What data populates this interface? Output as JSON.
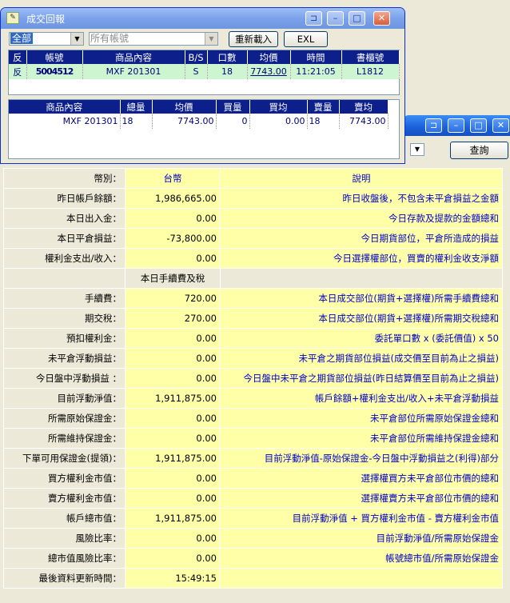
{
  "bg_window": {
    "query_button": "查詢",
    "summary": {
      "header": {
        "label": "幣別：",
        "currency": "台幣",
        "desc": "說明"
      },
      "section_label": "本日手續費及稅",
      "rows": [
        {
          "label": "昨日帳戶餘額：",
          "value": "1,986,665.00",
          "desc": "昨日收盤後，不包含未平倉損益之金額"
        },
        {
          "label": "本日出入金：",
          "value": "0.00",
          "desc": "今日存款及提款的金額總和"
        },
        {
          "label": "本日平倉損益：",
          "value": "-73,800.00",
          "desc": "今日期貨部位，平倉所造成的損益"
        },
        {
          "label": "權利金支出/收入：",
          "value": "0.00",
          "desc": "今日選擇權部位，買賣的權利金收支淨額"
        }
      ],
      "rows2": [
        {
          "label": "手續費：",
          "value": "720.00",
          "desc": "本日成交部位(期貨+選擇權)所需手續費總和"
        },
        {
          "label": "期交稅：",
          "value": "270.00",
          "desc": "本日成交部位(期貨+選擇權)所需期交稅總和"
        },
        {
          "label": "預扣權利金：",
          "value": "0.00",
          "desc": "委託單口數 x (委託價值) x 50"
        },
        {
          "label": "未平倉浮動損益：",
          "value": "0.00",
          "desc": "未平倉之期貨部位損益(成交價至目前為止之損益)"
        },
        {
          "label": "今日盤中浮動損益 ：",
          "value": "0.00",
          "desc": "今日盤中未平倉之期貨部位損益(昨日結算價至目前為止之損益)"
        },
        {
          "label": "目前浮動淨值：",
          "value": "1,911,875.00",
          "desc": "帳戶餘額+權利金支出/收入+未平倉浮動損益"
        },
        {
          "label": "所需原始保證金：",
          "value": "0.00",
          "desc": "未平倉部位所需原始保證金總和"
        },
        {
          "label": "所需維持保證金：",
          "value": "0.00",
          "desc": "未平倉部位所需維持保證金總和"
        },
        {
          "label": "下單可用保證金(提領)：",
          "value": "1,911,875.00",
          "desc": "目前浮動淨值-原始保證金-今日盤中浮動損益之(利得)部分"
        },
        {
          "label": "買方權利金市值：",
          "value": "0.00",
          "desc": "選擇權買方未平倉部位市價的總和"
        },
        {
          "label": "賣方權利金市值：",
          "value": "0.00",
          "desc": "選擇權賣方未平倉部位市價的總和"
        },
        {
          "label": "帳戶總市值：",
          "value": "1,911,875.00",
          "desc": "目前浮動淨值 + 買方權利金市值 - 賣方權利金市值"
        },
        {
          "label": "風險比率：",
          "value": "0.00",
          "desc": "目前浮動淨值/所需原始保證金"
        },
        {
          "label": "總市值風險比率：",
          "value": "0.00",
          "desc": "帳號總市值/所需原始保證金"
        },
        {
          "label": "最後資料更新時間：",
          "value": "15:49:15",
          "desc": ""
        }
      ]
    }
  },
  "fg_window": {
    "title": "成交回報",
    "filter_select": "全部",
    "account_select": "所有帳號",
    "reload_button": "重新載入",
    "excel_button": "EXL",
    "trades": {
      "columns": [
        "反",
        "帳號",
        "商品內容",
        "B/S",
        "口數",
        "均價",
        "時間",
        "書櫃號"
      ],
      "rows": [
        {
          "flag": "反",
          "account": "5004512",
          "product": "MXF 201301",
          "side": "S",
          "qty": "18",
          "price": "7743.00",
          "time": "11:21:05",
          "book": "L1812"
        }
      ]
    },
    "positions": {
      "columns": [
        "商品內容",
        "總量",
        "均價",
        "買量",
        "買均",
        "賣量",
        "賣均"
      ],
      "rows": [
        {
          "product": "MXF 201301",
          "total": "18",
          "avg": "7743.00",
          "buy_qty": "0",
          "buy_avg": "0.00",
          "sell_qty": "18",
          "sell_avg": "7743.00"
        }
      ]
    }
  }
}
